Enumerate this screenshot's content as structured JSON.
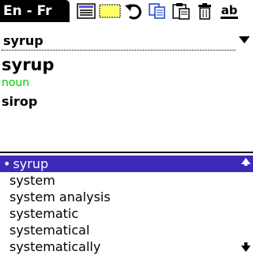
{
  "titlebar": {
    "language_pair": "En - Fr"
  },
  "toolbar": {
    "icons": [
      "list-icon",
      "note-icon",
      "undo-icon",
      "copy-icon",
      "paste-icon",
      "trash-icon",
      "text-style-icon"
    ],
    "text_style_label": "ab"
  },
  "lookup": {
    "value": "syrup",
    "placeholder": ""
  },
  "entry": {
    "headword": "syrup",
    "part_of_speech": "noun",
    "translation": "sirop"
  },
  "word_list": {
    "selected_prefix": "•",
    "items": [
      "syrup",
      "system",
      "system analysis",
      "systematic",
      "systematical",
      "systematically"
    ]
  },
  "colors": {
    "selection": "#3b2bb8",
    "part_of_speech": "#00cc00"
  }
}
